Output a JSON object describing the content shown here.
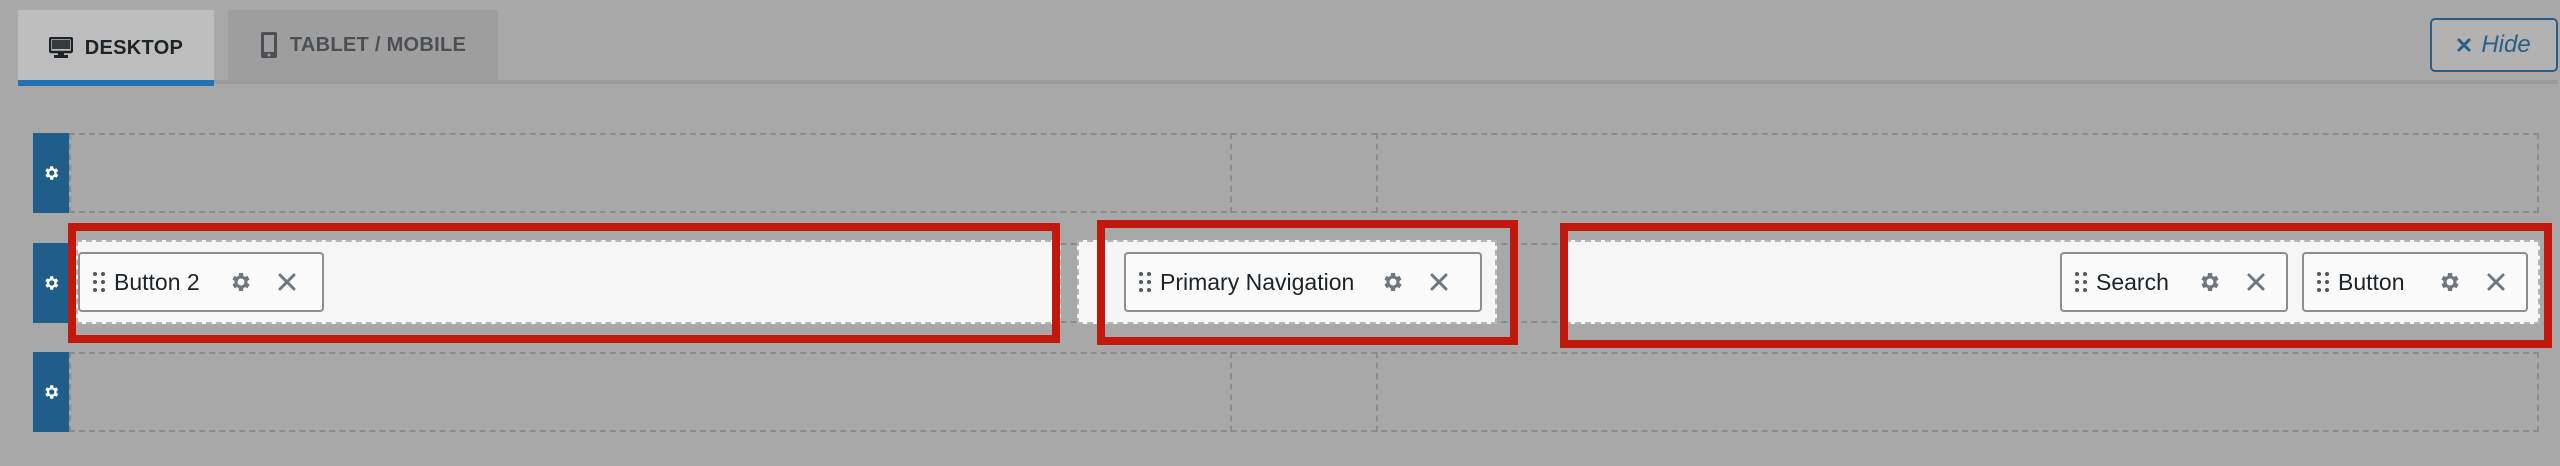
{
  "tabs": [
    {
      "label": "DESKTOP",
      "icon": "desktop-icon",
      "active": true
    },
    {
      "label": "TABLET / MOBILE",
      "icon": "tablet-icon",
      "active": false
    }
  ],
  "hide_button": {
    "label": "Hide",
    "icon": "close-icon"
  },
  "rows": {
    "top": {
      "name": "top-row"
    },
    "main": {
      "left_items": [
        {
          "label": "Button 2"
        }
      ],
      "center_items": [
        {
          "label": "Primary Navigation"
        }
      ],
      "right_items": [
        {
          "label": "Search"
        },
        {
          "label": "Button"
        }
      ]
    },
    "bottom": {
      "name": "bottom-row"
    }
  },
  "colors": {
    "accent": "#2271b1",
    "highlight": "#c0180c",
    "row_handle": "#1f5e8a"
  }
}
